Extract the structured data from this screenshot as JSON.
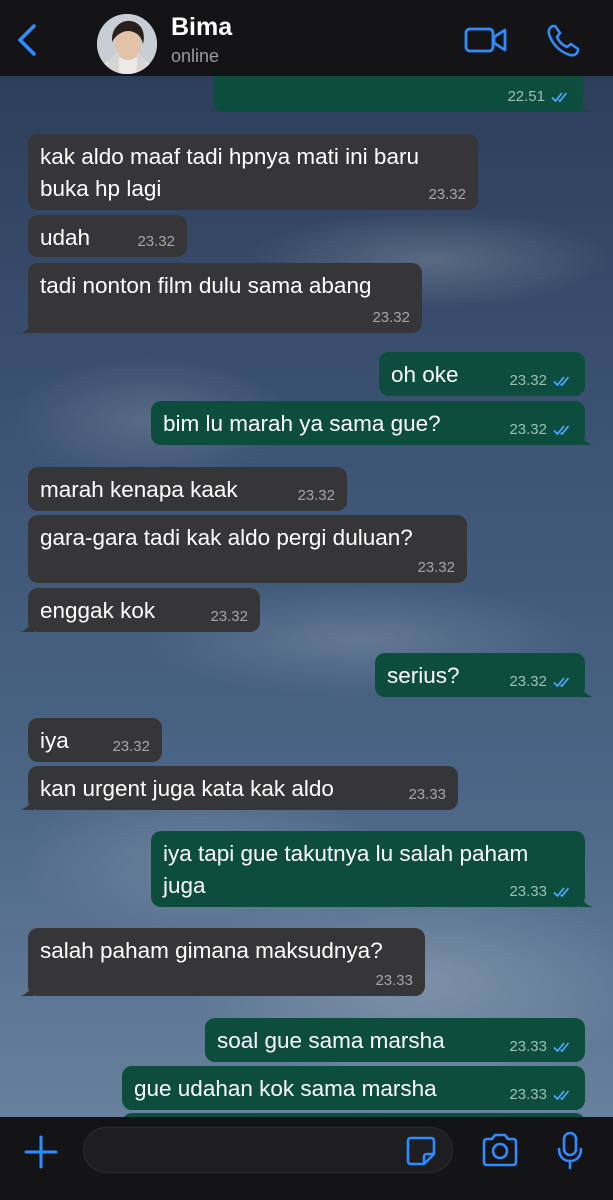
{
  "header": {
    "contact_name": "Bima",
    "status": "online",
    "back_icon": "chevron-left-icon",
    "video_icon": "video-camera-icon",
    "call_icon": "phone-icon"
  },
  "messages": [
    {
      "dir": "out",
      "text": "",
      "time": "22.51",
      "read": true
    },
    {
      "dir": "in",
      "text": "kak aldo maaf tadi hpnya mati ini baru buka hp lagi",
      "time": "23.32"
    },
    {
      "dir": "in",
      "text": "udah",
      "time": "23.32"
    },
    {
      "dir": "in",
      "text": "tadi nonton film dulu sama abang",
      "time": "23.32"
    },
    {
      "dir": "out",
      "text": "oh oke",
      "time": "23.32",
      "read": true
    },
    {
      "dir": "out",
      "text": "bim lu marah ya sama gue?",
      "time": "23.32",
      "read": true
    },
    {
      "dir": "in",
      "text": "marah kenapa kaak",
      "time": "23.32"
    },
    {
      "dir": "in",
      "text": "gara-gara tadi kak aldo pergi duluan?",
      "time": "23.32"
    },
    {
      "dir": "in",
      "text": "enggak kok",
      "time": "23.32"
    },
    {
      "dir": "out",
      "text": "serius?",
      "time": "23.32",
      "read": true
    },
    {
      "dir": "in",
      "text": "iya",
      "time": "23.32"
    },
    {
      "dir": "in",
      "text": "kan urgent juga kata kak aldo",
      "time": "23.33"
    },
    {
      "dir": "out",
      "text": "iya tapi gue takutnya lu salah paham juga",
      "time": "23.33",
      "read": true
    },
    {
      "dir": "in",
      "text": "salah paham gimana maksudnya?",
      "time": "23.33"
    },
    {
      "dir": "out",
      "text": "soal gue sama marsha",
      "time": "23.33",
      "read": true
    },
    {
      "dir": "out",
      "text": "gue udahan kok sama marsha",
      "time": "23.33",
      "read": true
    }
  ],
  "composer": {
    "input_value": "",
    "plus_icon": "plus-icon",
    "sticker_icon": "sticker-icon",
    "camera_icon": "camera-icon",
    "mic_icon": "microphone-icon"
  },
  "colors": {
    "accent": "#2f8cff",
    "incoming_bubble": "#363638",
    "outgoing_bubble": "#0c4d3e",
    "read_ticks": "#4fa8ff"
  }
}
